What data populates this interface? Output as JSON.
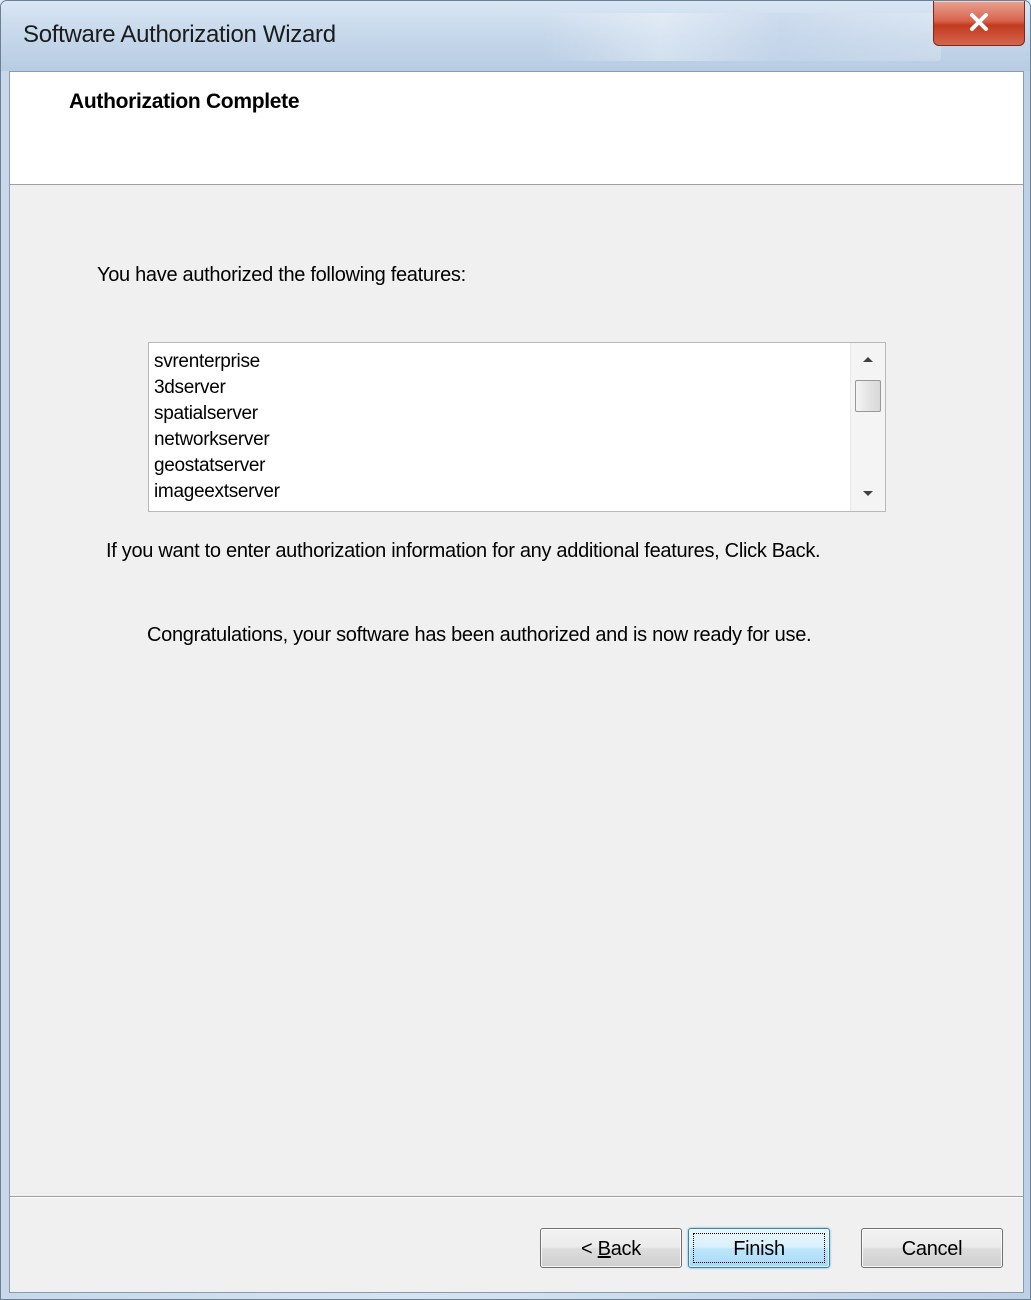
{
  "window": {
    "title": "Software Authorization Wizard"
  },
  "header": {
    "title": "Authorization Complete"
  },
  "content": {
    "intro": "You have authorized the following features:",
    "features": [
      "svrenterprise",
      "3dserver",
      "spatialserver",
      "networkserver",
      "geostatserver",
      "imageextserver"
    ],
    "back_hint": "If you want to enter authorization information for any additional features, Click Back.",
    "congratulations": "Congratulations, your software has been authorized and is now ready for use."
  },
  "buttons": {
    "back_prefix": "< ",
    "back_mnemonic": "B",
    "back_rest": "ack",
    "finish": "Finish",
    "cancel": "Cancel"
  },
  "icons": {
    "close": "close-icon",
    "scroll_up": "scroll-up-arrow-icon",
    "scroll_down": "scroll-down-arrow-icon"
  },
  "colors": {
    "close_button": "#c23a1f",
    "dialog_background": "#f0f0f0",
    "default_button_border": "#3c7fb1"
  }
}
